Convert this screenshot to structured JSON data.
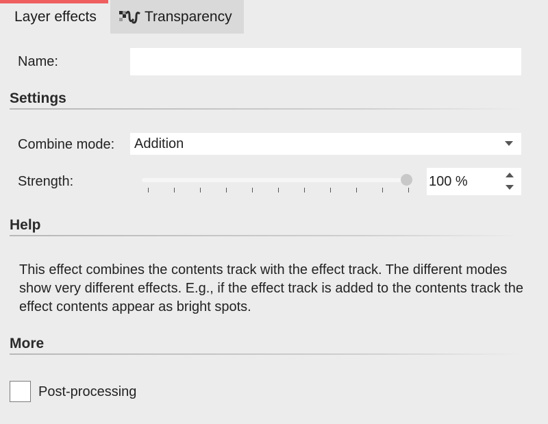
{
  "tabs": {
    "active_label": "Layer effects",
    "inactive_label": "Transparency",
    "inactive_icon": "transparency-icon"
  },
  "name": {
    "label": "Name:",
    "value": ""
  },
  "settings": {
    "title": "Settings",
    "combine_mode_label": "Combine mode:",
    "combine_mode_value": "Addition",
    "strength_label": "Strength:",
    "strength_value": "100 %",
    "strength_level": 1.0
  },
  "help": {
    "title": "Help",
    "text": "This effect combines the contents track with the effect track. The different modes show very different effects. E.g., if the effect track is added to the contents track the effect contents appear as bright spots."
  },
  "more": {
    "title": "More",
    "post_processing_label": "Post-processing",
    "post_processing_checked": false
  },
  "colors": {
    "background": "#ececec",
    "active_tab_accent": "#ef5f5f",
    "inactive_tab_bg": "#d9d9d9"
  }
}
